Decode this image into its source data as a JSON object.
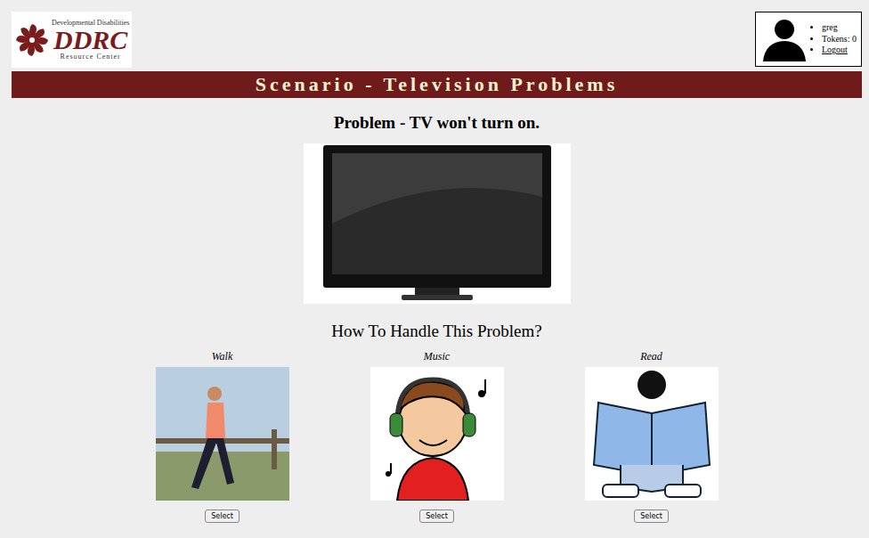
{
  "logo": {
    "line1": "Developmental Disabilities",
    "mark": "DDRC",
    "line2": "Resource Center"
  },
  "user": {
    "name": "greg",
    "tokens": "Tokens: 0",
    "logout": "Logout"
  },
  "banner": "Scenario - Television Problems",
  "problem": "Problem - TV won't turn on.",
  "question": "How To Handle This Problem?",
  "options": [
    {
      "label": "Walk",
      "button": "Select",
      "kind": "photo"
    },
    {
      "label": "Music",
      "button": "Select",
      "kind": "music"
    },
    {
      "label": "Read",
      "button": "Select",
      "kind": "read"
    }
  ]
}
